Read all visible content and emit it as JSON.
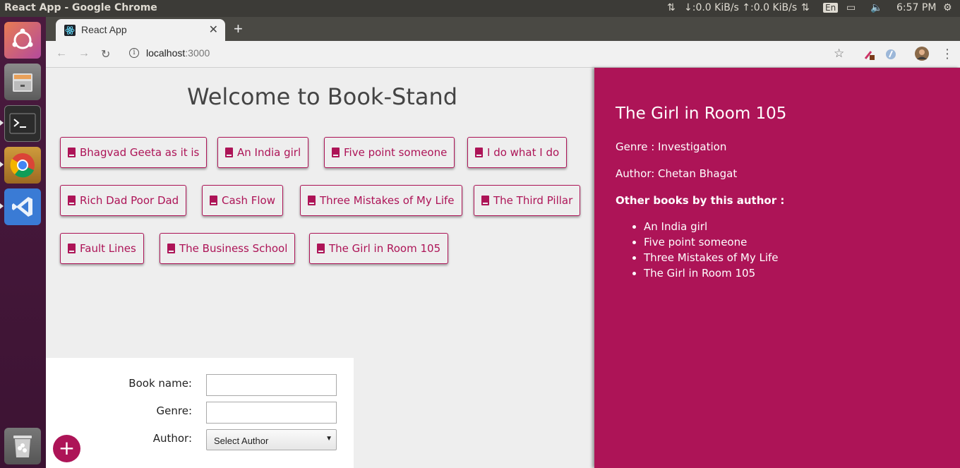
{
  "os": {
    "window_title": "React App - Google Chrome",
    "network": "↓:0.0 KiB/s ↑:0.0 KiB/s",
    "keyboard": "En",
    "clock": "6:57 PM"
  },
  "browser": {
    "tab_title": "React App",
    "url_host": "localhost",
    "url_port": ":3000"
  },
  "page": {
    "heading": "Welcome to Book-Stand",
    "books": [
      "Bhagvad Geeta as it is",
      "An India girl",
      "Five point someone",
      "I do what I do",
      "Rich Dad Poor Dad",
      "Cash Flow",
      "Three Mistakes of My Life",
      "The Third Pillar",
      "Fault Lines",
      "The Business School",
      "The Girl in Room 105"
    ],
    "form": {
      "book_name_label": "Book name:",
      "genre_label": "Genre:",
      "author_label": "Author:",
      "author_select": "Select Author",
      "add_button": "+"
    },
    "detail": {
      "title": "The Girl in Room 105",
      "genre": "Genre : Investigation",
      "author": "Author: Chetan Bhagat",
      "other_heading": "Other books by this author :",
      "other_books": [
        "An India girl",
        "Five point someone",
        "Three Mistakes of My Life",
        "The Girl in Room 105"
      ]
    }
  },
  "colors": {
    "accent": "#ad1457",
    "panel_bg": "#eeeeee"
  }
}
